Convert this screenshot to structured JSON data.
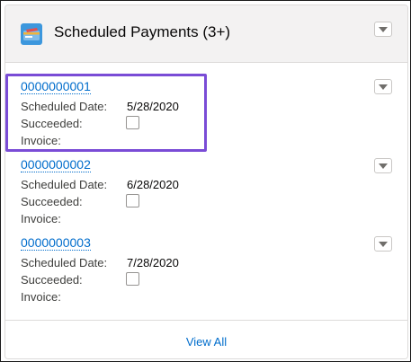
{
  "header": {
    "title": "Scheduled Payments (3+)",
    "icon": "payment-card-icon",
    "icon_color": "#3c97dd"
  },
  "labels": {
    "scheduled_date": "Scheduled Date:",
    "succeeded": "Succeeded:",
    "invoice": "Invoice:"
  },
  "records": [
    {
      "name": "0000000001",
      "scheduled_date": "5/28/2020",
      "succeeded": false,
      "invoice": ""
    },
    {
      "name": "0000000002",
      "scheduled_date": "6/28/2020",
      "succeeded": false,
      "invoice": ""
    },
    {
      "name": "0000000003",
      "scheduled_date": "7/28/2020",
      "succeeded": false,
      "invoice": ""
    }
  ],
  "footer": {
    "view_all": "View All"
  },
  "colors": {
    "link": "#006dcc",
    "highlight": "#7a4cd6",
    "header_bg": "#f3f2f2"
  }
}
